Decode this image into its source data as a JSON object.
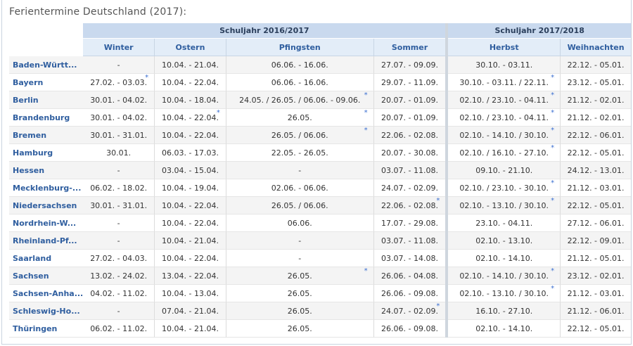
{
  "page_title": "Ferientermine Deutschland (2017):",
  "years": [
    "Schuljahr 2016/2017",
    "Schuljahr 2017/2018"
  ],
  "columns": [
    "Winter",
    "Ostern",
    "Pfingsten",
    "Sommer",
    "Herbst",
    "Weihnachten"
  ],
  "star_symbol": "*",
  "rows": [
    {
      "state": "Baden-Württ...",
      "cells": [
        {
          "t": "-"
        },
        {
          "t": "10.04. - 21.04."
        },
        {
          "t": "06.06. - 16.06."
        },
        {
          "t": "27.07. - 09.09."
        },
        {
          "t": "30.10. - 03.11."
        },
        {
          "t": "22.12. - 05.01."
        }
      ]
    },
    {
      "state": "Bayern",
      "cells": [
        {
          "t": "27.02. - 03.03.",
          "s": true
        },
        {
          "t": "10.04. - 22.04."
        },
        {
          "t": "06.06. - 16.06."
        },
        {
          "t": "29.07. - 11.09."
        },
        {
          "t": "30.10. - 03.11. / 22.11.",
          "s": true
        },
        {
          "t": "23.12. - 05.01."
        }
      ]
    },
    {
      "state": "Berlin",
      "cells": [
        {
          "t": "30.01. - 04.02."
        },
        {
          "t": "10.04. - 18.04."
        },
        {
          "t": "24.05. / 26.05. / 06.06. - 09.06.",
          "s": true
        },
        {
          "t": "20.07. - 01.09."
        },
        {
          "t": "02.10. / 23.10. - 04.11.",
          "s": true
        },
        {
          "t": "21.12. - 02.01."
        }
      ]
    },
    {
      "state": "Brandenburg",
      "cells": [
        {
          "t": "30.01. - 04.02."
        },
        {
          "t": "10.04. - 22.04.",
          "s": true
        },
        {
          "t": "26.05.",
          "s": true
        },
        {
          "t": "20.07. - 01.09."
        },
        {
          "t": "02.10. / 23.10. - 04.11.",
          "s": true
        },
        {
          "t": "21.12. - 02.01."
        }
      ]
    },
    {
      "state": "Bremen",
      "cells": [
        {
          "t": "30.01. - 31.01."
        },
        {
          "t": "10.04. - 22.04."
        },
        {
          "t": "26.05. / 06.06.",
          "s": true
        },
        {
          "t": "22.06. - 02.08."
        },
        {
          "t": "02.10. - 14.10. / 30.10.",
          "s": true
        },
        {
          "t": "22.12. - 06.01."
        }
      ]
    },
    {
      "state": "Hamburg",
      "cells": [
        {
          "t": "30.01."
        },
        {
          "t": "06.03. - 17.03."
        },
        {
          "t": "22.05. - 26.05."
        },
        {
          "t": "20.07. - 30.08."
        },
        {
          "t": "02.10. / 16.10. - 27.10.",
          "s": true
        },
        {
          "t": "22.12. - 05.01."
        }
      ]
    },
    {
      "state": "Hessen",
      "cells": [
        {
          "t": "-"
        },
        {
          "t": "03.04. - 15.04."
        },
        {
          "t": "-"
        },
        {
          "t": "03.07. - 11.08."
        },
        {
          "t": "09.10. - 21.10."
        },
        {
          "t": "24.12. - 13.01."
        }
      ]
    },
    {
      "state": "Mecklenburg-...",
      "cells": [
        {
          "t": "06.02. - 18.02."
        },
        {
          "t": "10.04. - 19.04."
        },
        {
          "t": "02.06. - 06.06."
        },
        {
          "t": "24.07. - 02.09."
        },
        {
          "t": "02.10. / 23.10. - 30.10.",
          "s": true
        },
        {
          "t": "21.12. - 03.01."
        }
      ]
    },
    {
      "state": "Niedersachsen",
      "cells": [
        {
          "t": "30.01. - 31.01."
        },
        {
          "t": "10.04. - 22.04."
        },
        {
          "t": "26.05. / 06.06."
        },
        {
          "t": "22.06. - 02.08.",
          "s": true
        },
        {
          "t": "02.10. - 13.10. / 30.10.",
          "s": true
        },
        {
          "t": "22.12. - 05.01."
        }
      ]
    },
    {
      "state": "Nordrhein-W...",
      "cells": [
        {
          "t": "-"
        },
        {
          "t": "10.04. - 22.04."
        },
        {
          "t": "06.06."
        },
        {
          "t": "17.07. - 29.08."
        },
        {
          "t": "23.10. - 04.11."
        },
        {
          "t": "27.12. - 06.01."
        }
      ]
    },
    {
      "state": "Rheinland-Pf...",
      "cells": [
        {
          "t": "-"
        },
        {
          "t": "10.04. - 21.04."
        },
        {
          "t": "-"
        },
        {
          "t": "03.07. - 11.08."
        },
        {
          "t": "02.10. - 13.10."
        },
        {
          "t": "22.12. - 09.01."
        }
      ]
    },
    {
      "state": "Saarland",
      "cells": [
        {
          "t": "27.02. - 04.03."
        },
        {
          "t": "10.04. - 22.04."
        },
        {
          "t": "-"
        },
        {
          "t": "03.07. - 14.08."
        },
        {
          "t": "02.10. - 14.10."
        },
        {
          "t": "21.12. - 05.01."
        }
      ]
    },
    {
      "state": "Sachsen",
      "cells": [
        {
          "t": "13.02. - 24.02."
        },
        {
          "t": "13.04. - 22.04."
        },
        {
          "t": "26.05.",
          "s": true
        },
        {
          "t": "26.06. - 04.08."
        },
        {
          "t": "02.10. - 14.10. / 30.10.",
          "s": true
        },
        {
          "t": "23.12. - 02.01."
        }
      ]
    },
    {
      "state": "Sachsen-Anha...",
      "cells": [
        {
          "t": "04.02. - 11.02."
        },
        {
          "t": "10.04. - 13.04."
        },
        {
          "t": "26.05."
        },
        {
          "t": "26.06. - 09.08."
        },
        {
          "t": "02.10. - 13.10. / 30.10.",
          "s": true
        },
        {
          "t": "21.12. - 03.01."
        }
      ]
    },
    {
      "state": "Schleswig-Ho...",
      "cells": [
        {
          "t": "-"
        },
        {
          "t": "07.04. - 21.04."
        },
        {
          "t": "26.05."
        },
        {
          "t": "24.07. - 02.09.",
          "s": true
        },
        {
          "t": "16.10. - 27.10."
        },
        {
          "t": "21.12. - 06.01."
        }
      ]
    },
    {
      "state": "Thüringen",
      "cells": [
        {
          "t": "06.02. - 11.02."
        },
        {
          "t": "10.04. - 21.04."
        },
        {
          "t": "26.05."
        },
        {
          "t": "26.06. - 09.08."
        },
        {
          "t": "02.10. - 14.10."
        },
        {
          "t": "22.12. - 05.01."
        }
      ]
    }
  ],
  "colors": {
    "accent": "#2f5e9f",
    "year_header_bg": "#c9d9ee",
    "col_header_bg": "#e3edf8",
    "star": "#3a6fd0"
  }
}
